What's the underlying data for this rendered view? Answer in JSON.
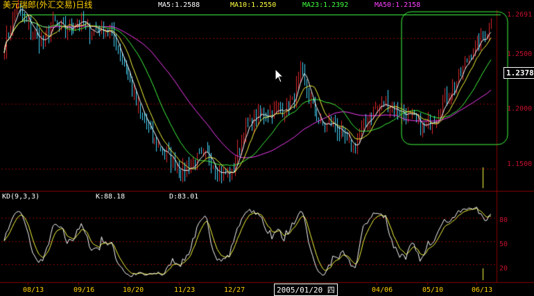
{
  "header": {
    "title": "美元瑞郎(外汇交易)日线",
    "ma5": "MA5:1.2588",
    "ma10": "MA10:1.2550",
    "ma23": "MA23:1.2392",
    "ma50": "MA50:1.2158"
  },
  "price_axis": {
    "top_label": "1.2691",
    "levels": [
      "1.2500",
      "1.2000",
      "1.1500"
    ],
    "last_price": "1.2378"
  },
  "kd_panel": {
    "title": "KD(9,3,3)",
    "k_value": "K:88.18",
    "d_value": "D:83.01",
    "levels": [
      "80",
      "50",
      "20"
    ]
  },
  "date_axis": {
    "labels": [
      "08/13",
      "09/16",
      "10/20",
      "11/23",
      "12/27",
      "04/06",
      "05/10",
      "06/13"
    ],
    "cursor_date": "2005/01/20 四"
  },
  "colors": {
    "up_candle": "#e0282e",
    "down_candle": "#45d8ff",
    "ma5": "#ffffff",
    "ma10": "#ffff40",
    "ma23": "#40ff40",
    "ma50": "#ff40ff",
    "grid": "#8a0000",
    "annotation": "#40ff40",
    "k_line": "#ffffff",
    "d_line": "#ffff40"
  },
  "chart_data": {
    "type": "candlestick",
    "symbol": "美元瑞郎(外汇交易)",
    "period": "日线",
    "price_ticks": [
      1.25,
      1.2,
      1.15
    ],
    "ylim": [
      1.135,
      1.272
    ],
    "top_price": 1.2691,
    "last_close": 1.2378,
    "anchors_index_close": [
      [
        0,
        1.245
      ],
      [
        6,
        1.275
      ],
      [
        14,
        1.255
      ],
      [
        19,
        1.245
      ],
      [
        24,
        1.262
      ],
      [
        30,
        1.255
      ],
      [
        36,
        1.265
      ],
      [
        42,
        1.255
      ],
      [
        48,
        1.258
      ],
      [
        52,
        1.255
      ],
      [
        58,
        1.235
      ],
      [
        66,
        1.195
      ],
      [
        74,
        1.17
      ],
      [
        82,
        1.157
      ],
      [
        88,
        1.148
      ],
      [
        94,
        1.155
      ],
      [
        100,
        1.16
      ],
      [
        106,
        1.148
      ],
      [
        112,
        1.145
      ],
      [
        118,
        1.18
      ],
      [
        124,
        1.19
      ],
      [
        130,
        1.192
      ],
      [
        136,
        1.195
      ],
      [
        142,
        1.2
      ],
      [
        146,
        1.225
      ],
      [
        150,
        1.205
      ],
      [
        156,
        1.182
      ],
      [
        162,
        1.185
      ],
      [
        168,
        1.172
      ],
      [
        172,
        1.165
      ],
      [
        176,
        1.18
      ],
      [
        182,
        1.195
      ],
      [
        188,
        1.2
      ],
      [
        194,
        1.195
      ],
      [
        200,
        1.19
      ],
      [
        206,
        1.18
      ],
      [
        212,
        1.19
      ],
      [
        218,
        1.205
      ],
      [
        224,
        1.22
      ],
      [
        230,
        1.24
      ],
      [
        236,
        1.25
      ],
      [
        240,
        1.262
      ]
    ],
    "kd": {
      "k_last": 88.18,
      "d_last": 83.01,
      "levels": [
        80,
        50,
        20
      ]
    }
  }
}
